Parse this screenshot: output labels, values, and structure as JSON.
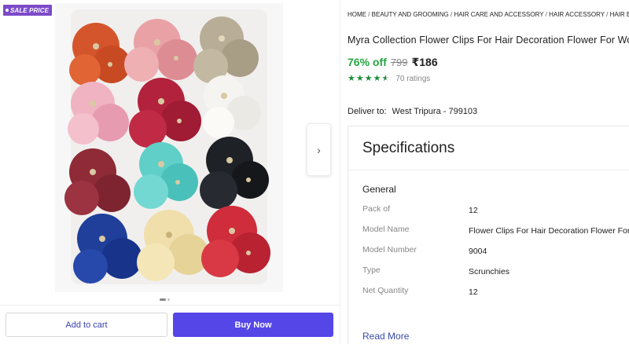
{
  "badge": {
    "label": "SALE PRICE"
  },
  "gallery": {
    "next_icon": "chevron-right-icon",
    "next_glyph": "›",
    "image_alt": "Flower hair clips",
    "dots_total": 2,
    "active_dot": 1
  },
  "actions": {
    "add_to_cart": "Add to cart",
    "buy_now": "Buy Now"
  },
  "breadcrumb": [
    "HOME",
    "BEAUTY AND GROOMING",
    "HAIR CARE AND ACCESSORY",
    "HAIR ACCESSORY",
    "HAIR BAND"
  ],
  "breadcrumb_separator": " / ",
  "breadcrumb_trailing": " /",
  "product": {
    "title": "Myra Collection Flower Clips For Hair Decoration Flower For Wo",
    "discount": "76% off",
    "mrp": "799",
    "price": "₹186",
    "rating_stars": 4.5,
    "ratings_count": "70 ratings"
  },
  "delivery": {
    "label": "Deliver to:",
    "location": "West Tripura - 799103"
  },
  "specifications": {
    "heading": "Specifications",
    "group": "General",
    "rows": [
      {
        "key": "Pack of",
        "value": "12"
      },
      {
        "key": "Model Name",
        "value": "Flower Clips For Hair Decoration Flower For W"
      },
      {
        "key": "Model Number",
        "value": "9004"
      },
      {
        "key": "Type",
        "value": "Scrunchies"
      },
      {
        "key": "Net Quantity",
        "value": "12"
      }
    ],
    "read_more": "Read More"
  },
  "colors": {
    "accent": "#5546e8",
    "badge": "#7c4ac9",
    "discount": "#26a541",
    "star": "#1e8a3a",
    "link": "#3a4ca8"
  }
}
